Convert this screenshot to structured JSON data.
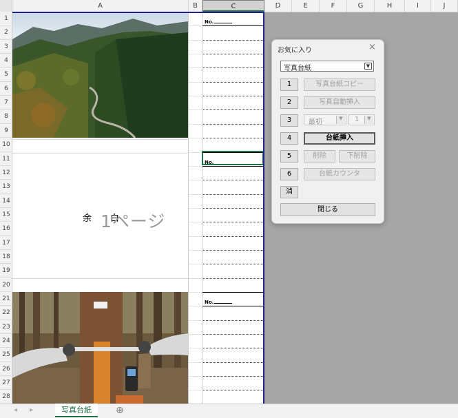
{
  "columns": [
    "A",
    "B",
    "C",
    "D",
    "E",
    "F",
    "G",
    "H",
    "I",
    "J"
  ],
  "rows": [
    "1",
    "2",
    "3",
    "4",
    "5",
    "6",
    "7",
    "8",
    "9",
    "10",
    "11",
    "12",
    "13",
    "14",
    "15",
    "16",
    "17",
    "18",
    "19",
    "20",
    "21",
    "22",
    "23",
    "24",
    "25",
    "26",
    "27",
    "28"
  ],
  "cells": {
    "no_label_1": "No.",
    "no_label_2": "No.",
    "no_label_3": "No.",
    "blank_small_1": "余",
    "blank_small_2": "白",
    "blank_large": "1ページ"
  },
  "dialog": {
    "title": "お気に入り",
    "close": "×",
    "combo_value": "写真台紙",
    "combo_arrow": "▼",
    "buttons": {
      "n1": "1",
      "n2": "2",
      "n3": "3",
      "n4": "4",
      "n5": "5",
      "n6": "6",
      "copy": "写真台紙コピー",
      "auto_insert": "写真自動挿入",
      "insert": "台紙挿入",
      "delete": "削除",
      "delete_below": "下削除",
      "counter": "台紙カウンタ",
      "erase": "消",
      "close": "閉じる"
    },
    "pos_select": "最初",
    "count_select": "1"
  },
  "sheet_tab": "写真台紙",
  "nav": {
    "prev": "◂",
    "next": "▸",
    "add": "⊕"
  },
  "colors": {
    "accent": "#217346",
    "page_border": "#1f1f8f",
    "selection": "#217346"
  }
}
